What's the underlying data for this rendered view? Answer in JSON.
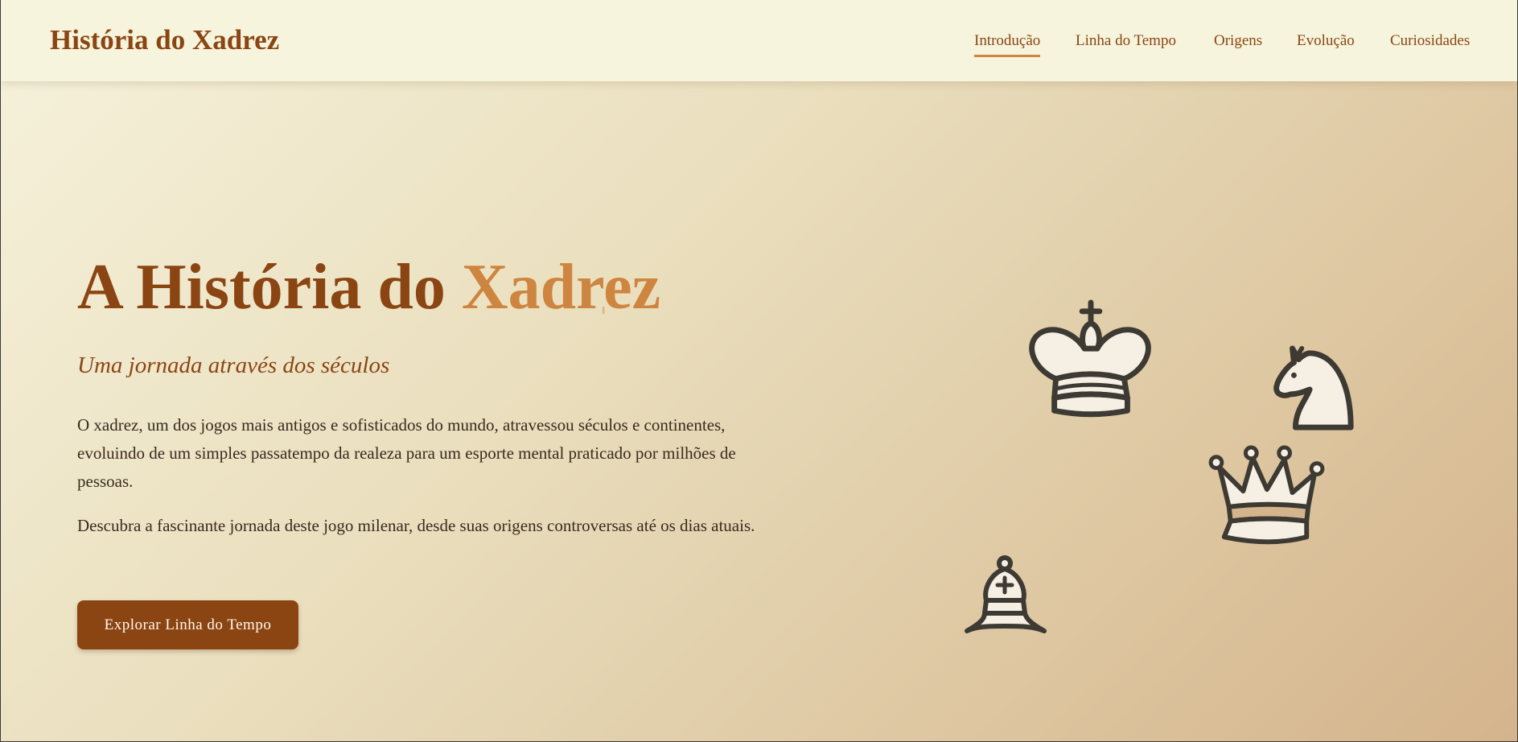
{
  "header": {
    "brand": "História do Xadrez",
    "nav": [
      {
        "label": "Introdução",
        "active": true
      },
      {
        "label": "Linha do Tempo"
      },
      {
        "label": "Origens"
      },
      {
        "label": "Evolução"
      },
      {
        "label": "Curiosidades"
      }
    ]
  },
  "hero": {
    "title_main": "A História do ",
    "title_accent": "Xadrez",
    "subtitle": "Uma jornada através dos séculos",
    "paragraphs": [
      "O xadrez, um dos jogos mais antigos e sofisticados do mundo, atravessou séculos e continentes, evoluindo de um simples passatempo da realeza para um esporte mental praticado por milhões de pessoas.",
      "Descubra a fascinante jornada deste jogo milenar, desde suas origens controversas até os dias atuais."
    ],
    "cta_label": "Explorar Linha do Tempo"
  },
  "pieces": [
    "king-icon",
    "knight-icon",
    "queen-icon",
    "bishop-icon"
  ],
  "colors": {
    "primary": "#8b4513",
    "accent": "#cd853f",
    "header_bg": "#f6f4dc",
    "piece_fill": "#f5efe4",
    "piece_stroke": "#3d3a33"
  }
}
